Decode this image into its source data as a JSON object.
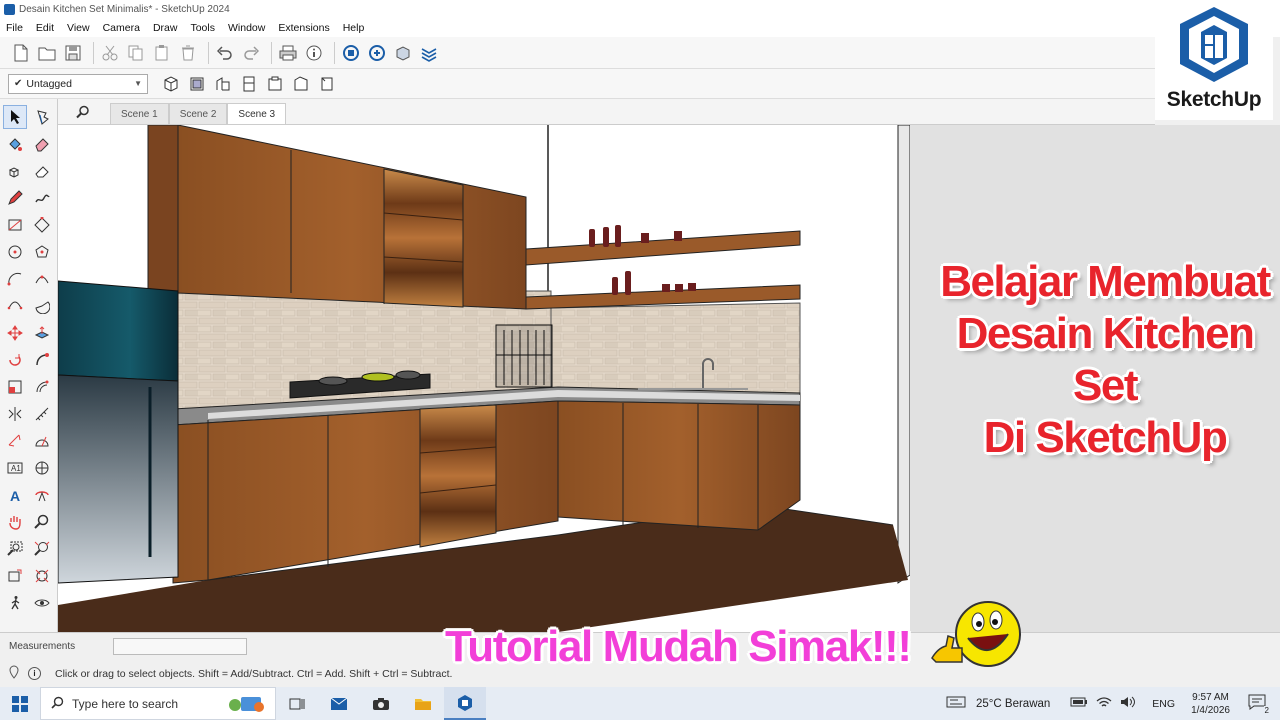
{
  "window": {
    "title": "Desain Kitchen Set Minimalis* - SketchUp 2024"
  },
  "menu": [
    "File",
    "Edit",
    "View",
    "Camera",
    "Draw",
    "Tools",
    "Window",
    "Extensions",
    "Help"
  ],
  "tag_selector": {
    "value": "Untagged"
  },
  "logo": {
    "text": "SketchUp"
  },
  "scenes": [
    {
      "label": "Scene 1",
      "active": false
    },
    {
      "label": "Scene 2",
      "active": false
    },
    {
      "label": "Scene 3",
      "active": true
    }
  ],
  "headline": {
    "line1": "Belajar Membuat",
    "line2": "Desain Kitchen Set",
    "line3": "Di SketchUp"
  },
  "tutorial": {
    "text": "Tutorial Mudah Simak!!!"
  },
  "measurements": {
    "label": "Measurements",
    "value": ""
  },
  "status": {
    "info_icon": "i",
    "text": "Click or drag to select objects. Shift = Add/Subtract. Ctrl = Add. Shift + Ctrl = Subtract."
  },
  "taskbar": {
    "search_placeholder": "Type here to search",
    "weather": "25°C  Berawan",
    "language": "ENG",
    "time": "9:57 AM",
    "date": "1/4/2026",
    "notification_count": "2"
  },
  "colors": {
    "headline": "#e8242c",
    "tutorial": "#f23fd8",
    "logo_blue": "#1b5ea8",
    "wood": "#9a5a2a",
    "floor": "#4a2c1a"
  }
}
